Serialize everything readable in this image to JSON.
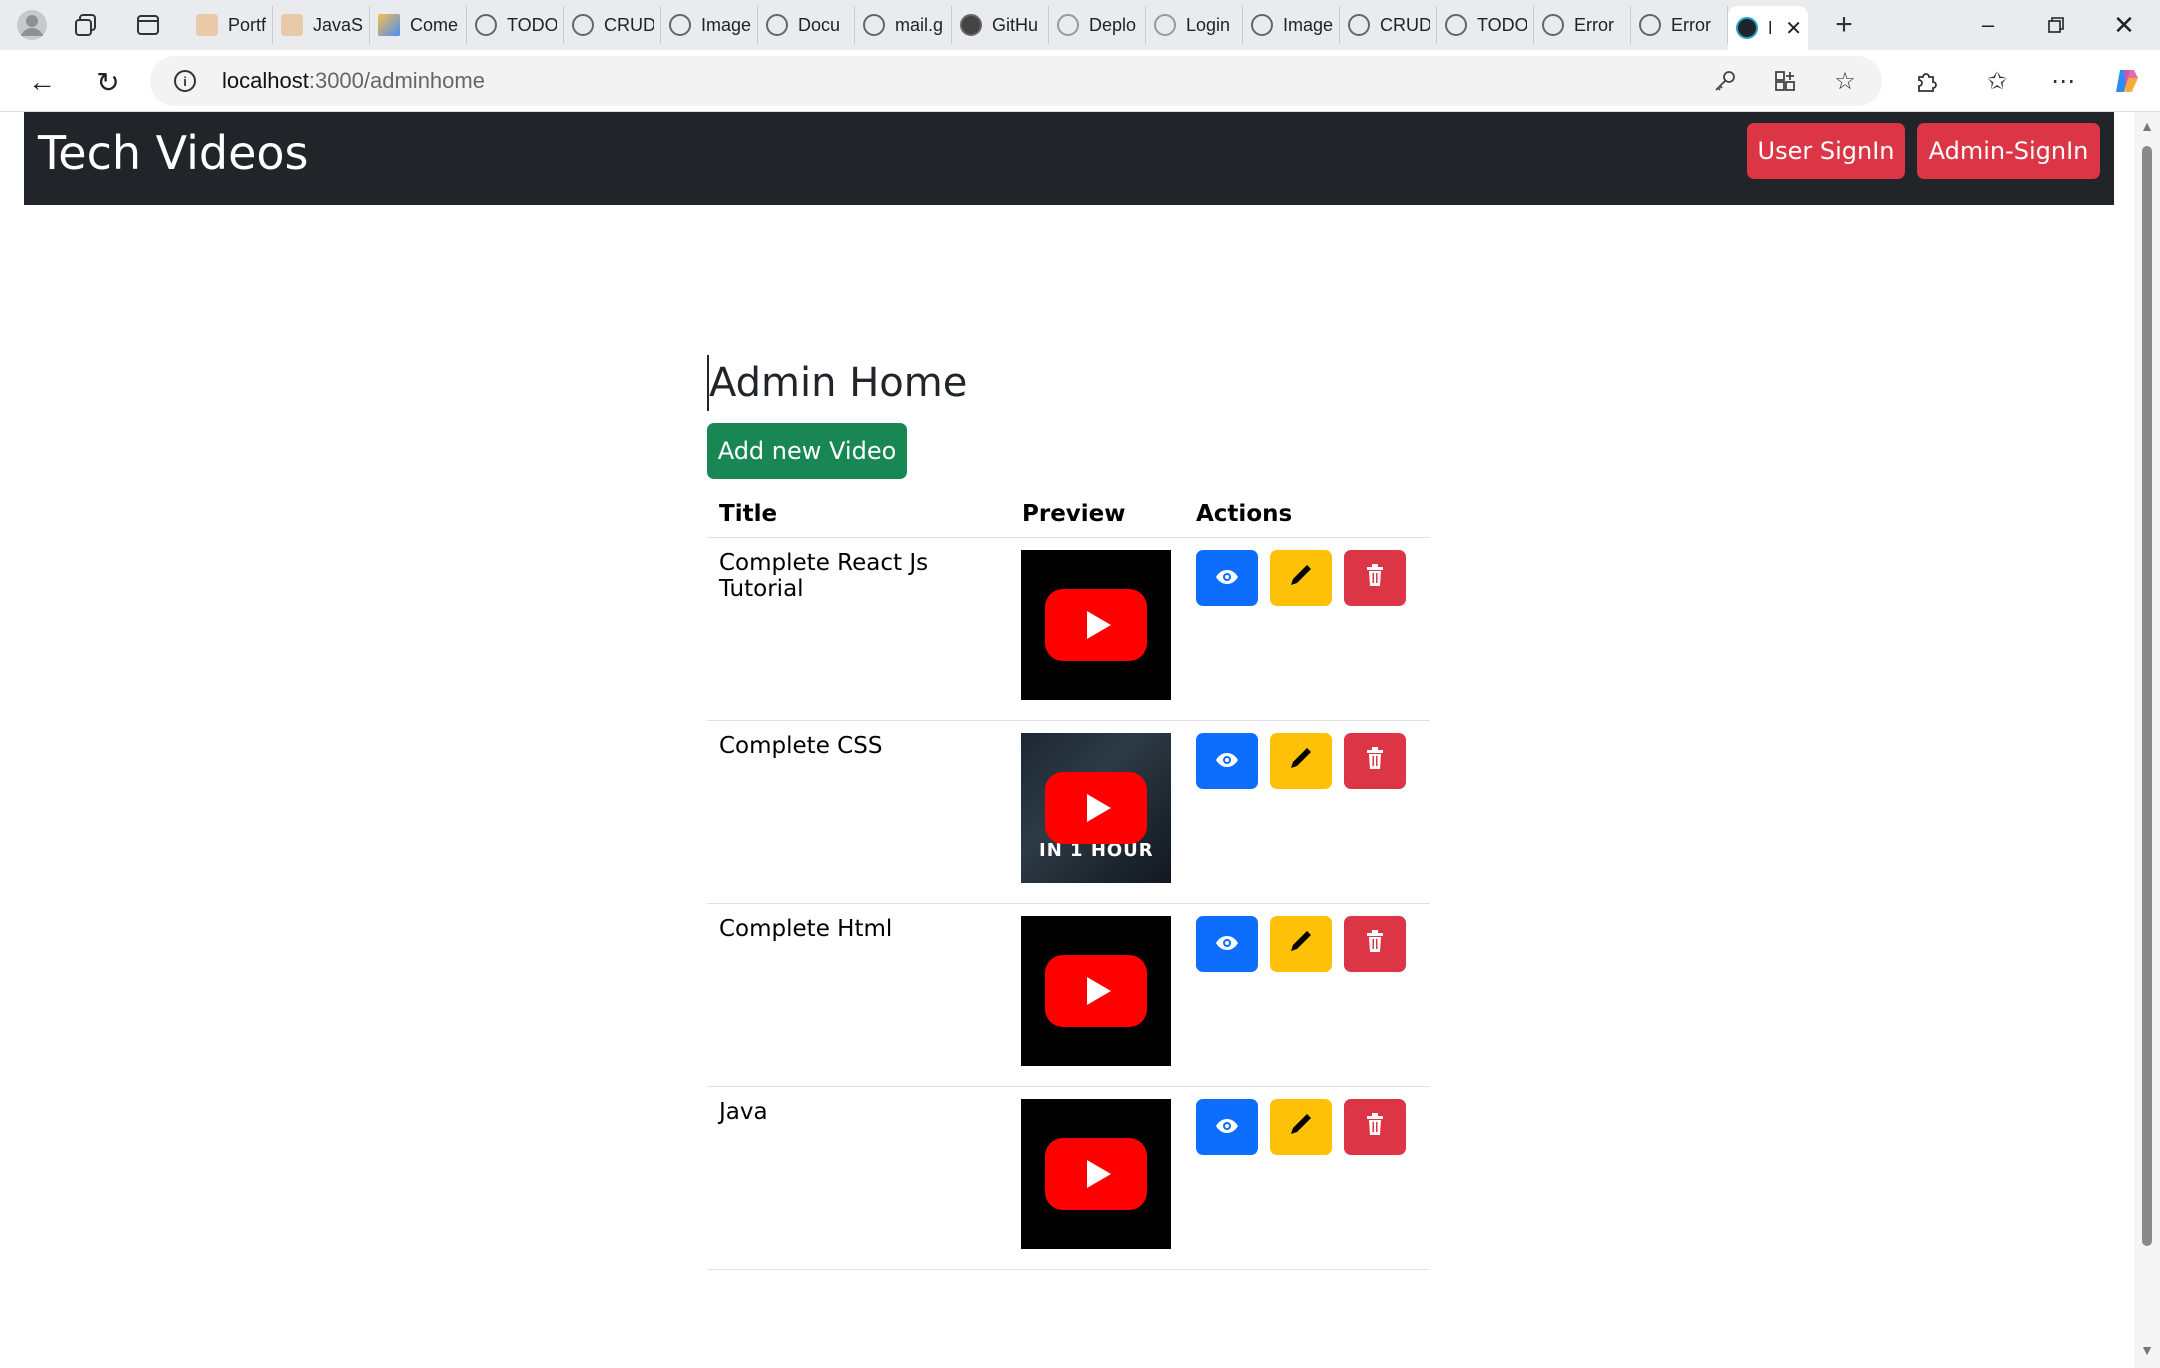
{
  "browser": {
    "tabs": [
      {
        "label": "Portfo",
        "icon": "portfolio-icon"
      },
      {
        "label": "JavaSc",
        "icon": "javascript-icon"
      },
      {
        "label": "Come",
        "icon": "drive-icon"
      },
      {
        "label": "TODO",
        "icon": "globe-icon"
      },
      {
        "label": "CRUD",
        "icon": "globe-icon"
      },
      {
        "label": "Image",
        "icon": "globe-icon"
      },
      {
        "label": "Docu",
        "icon": "globe-icon"
      },
      {
        "label": "mail.g",
        "icon": "globe-icon"
      },
      {
        "label": "GitHu",
        "icon": "github-icon"
      },
      {
        "label": "Deplo",
        "icon": "render-icon"
      },
      {
        "label": "Login",
        "icon": "render-icon"
      },
      {
        "label": "Image",
        "icon": "globe-icon"
      },
      {
        "label": "CRUD",
        "icon": "globe-icon"
      },
      {
        "label": "TODO",
        "icon": "globe-icon"
      },
      {
        "label": "Error",
        "icon": "globe-icon"
      },
      {
        "label": "Error",
        "icon": "globe-icon"
      },
      {
        "label": "F",
        "icon": "react-icon"
      }
    ],
    "url_host": "localhost",
    "url_path": ":3000/adminhome"
  },
  "navbar": {
    "brand": "Tech Videos",
    "user_signin": "User SignIn",
    "admin_signin": "Admin-SignIn"
  },
  "main": {
    "title": "Admin Home",
    "add_button": "Add new Video",
    "columns": [
      "Title",
      "Preview",
      "Actions"
    ],
    "videos": [
      {
        "title": "Complete React Js Tutorial",
        "thumbnail": "black"
      },
      {
        "title": "Complete CSS",
        "thumbnail": "css-image",
        "overlay_text": "IN 1 HOUR"
      },
      {
        "title": "Complete Html",
        "thumbnail": "black"
      },
      {
        "title": "Java",
        "thumbnail": "black"
      }
    ]
  },
  "colors": {
    "navbar_bg": "#212529",
    "danger": "#dc3545",
    "success": "#198754",
    "primary": "#0d6efd",
    "warning": "#ffc107"
  }
}
